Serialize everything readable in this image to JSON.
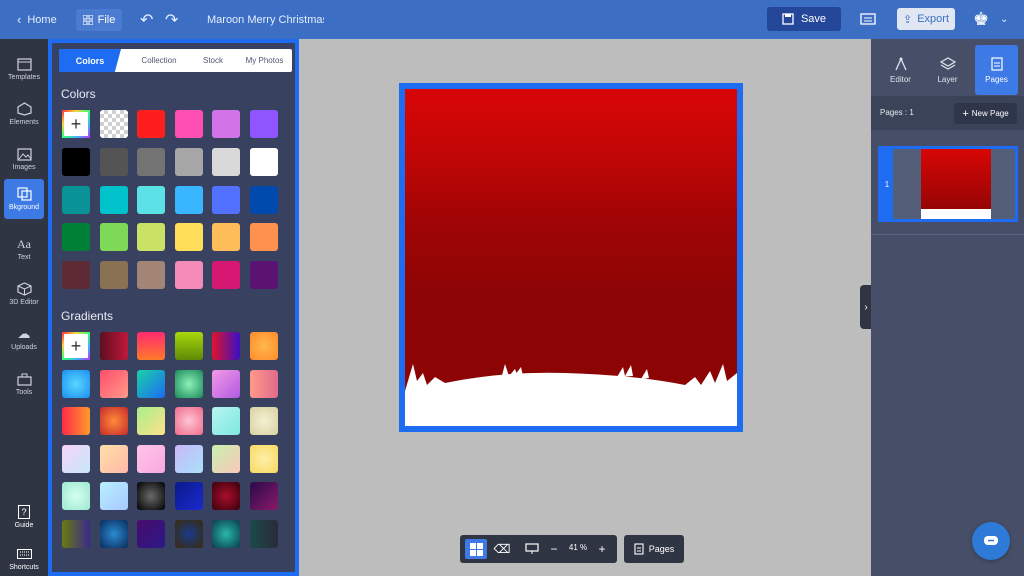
{
  "topbar": {
    "home_label": "Home",
    "file_label": "File",
    "title": "Maroon Merry Christmas (",
    "save_label": "Save",
    "export_label": "Export"
  },
  "leftnav": {
    "items": [
      {
        "label": "Templates",
        "icon": "templates-icon"
      },
      {
        "label": "Elements",
        "icon": "elements-icon"
      },
      {
        "label": "Images",
        "icon": "images-icon"
      },
      {
        "label": "Bkground",
        "icon": "background-icon"
      },
      {
        "label": "Text",
        "icon": "text-icon"
      },
      {
        "label": "3D Editor",
        "icon": "3d-editor-icon"
      },
      {
        "label": "Uploads",
        "icon": "uploads-icon"
      },
      {
        "label": "Tools",
        "icon": "tools-icon"
      }
    ],
    "guide_label": "Guide",
    "shortcuts_label": "Shortcuts",
    "active": "Bkground"
  },
  "panel": {
    "tabs": [
      "Colors",
      "Collection",
      "Stock",
      "My Photos"
    ],
    "colors_title": "Colors",
    "gradients_title": "Gradients",
    "colors": [
      "add",
      "transparent",
      "#ff1e1e",
      "#ff4fb5",
      "#d273e8",
      "#8f55ff",
      "#000000",
      "#545454",
      "#737373",
      "#a6a6a6",
      "#d9d9d9",
      "#ffffff",
      "#0a9396",
      "#00c2cb",
      "#5ce1e6",
      "#38b6ff",
      "#5271ff",
      "#004aad",
      "#008037",
      "#7ed957",
      "#c9e265",
      "#ffde59",
      "#ffbd59",
      "#ff914d",
      "#5e2b34",
      "#8a7153",
      "#a38575",
      "#f58bb8",
      "#d61872",
      "#5c1270"
    ],
    "gradients": [
      "add",
      "linear-gradient(90deg,#5e0f20,#c0183a)",
      "linear-gradient(180deg,#ff2a6f,#ff7a2a)",
      "linear-gradient(180deg,#a8d80c,#5e8a06)",
      "linear-gradient(90deg,#e0142a,#3a0fc4)",
      "radial-gradient(circle,#ffb84d,#ff8a2a)",
      "radial-gradient(circle,#59d8ff,#1c8cf0)",
      "linear-gradient(135deg,#ff4d6a,#ff9a8a)",
      "linear-gradient(135deg,#19d1a8,#1c6cf2)",
      "radial-gradient(circle,#8df0b8,#1a8a5a)",
      "linear-gradient(135deg,#f59ae8,#b05ae0)",
      "linear-gradient(90deg,#ff9a8a,#e06a8a)",
      "linear-gradient(90deg,#ff2a4a,#ff9a2a)",
      "radial-gradient(circle,#ff8a3a,#c42a2a)",
      "linear-gradient(135deg,#a8f08a,#ffe08a)",
      "radial-gradient(circle,#ffc4d4,#f06a8a)",
      "linear-gradient(135deg,#b8f4f0,#7ee8e0)",
      "radial-gradient(circle,#f4f0d4,#d8d0a0)",
      "linear-gradient(135deg,#f4d4f8,#c8e8f8)",
      "linear-gradient(135deg,#ffe0a8,#ffb8a8)",
      "linear-gradient(135deg,#ffc4e8,#f8a8e0)",
      "linear-gradient(135deg,#c8b8f8,#a8e0f8)",
      "linear-gradient(135deg,#c8f0b0,#f8c8b8)",
      "radial-gradient(circle,#fff0a8,#f8d860)",
      "radial-gradient(circle,#d8fff0,#9ae8d0)",
      "linear-gradient(135deg,#b8f0ff,#a8c8ff)",
      "radial-gradient(circle,#6a6a6a,#000000)",
      "linear-gradient(135deg,#0a1a8a,#1a2ad0)",
      "radial-gradient(circle,#a8102a,#3a0010)",
      "linear-gradient(135deg,#2a0a4a,#8a1a6a)",
      "linear-gradient(90deg,#6a7a10,#3a2a8a)",
      "radial-gradient(circle,#2a8ad0,#0a2a5a)",
      "linear-gradient(135deg,#4a0a6a,#2a1a8a)",
      "radial-gradient(circle,#1a3a8a,#3a2a0a)",
      "radial-gradient(circle,#2ab8a8,#0a3a4a)",
      "linear-gradient(90deg,#1a4a4a,#2a2a3a)"
    ]
  },
  "bottom": {
    "zoom": "41 %",
    "pages_label": "Pages"
  },
  "rightpanel": {
    "tabs": [
      "Editor",
      "Layer",
      "Pages"
    ],
    "active": "Pages",
    "pages_count": "Pages : 1",
    "new_page_label": "New Page",
    "page_number": "1"
  },
  "colors": {
    "accent": "#1e6cf2",
    "topbar": "#3c6fc4",
    "panel": "#384160"
  }
}
